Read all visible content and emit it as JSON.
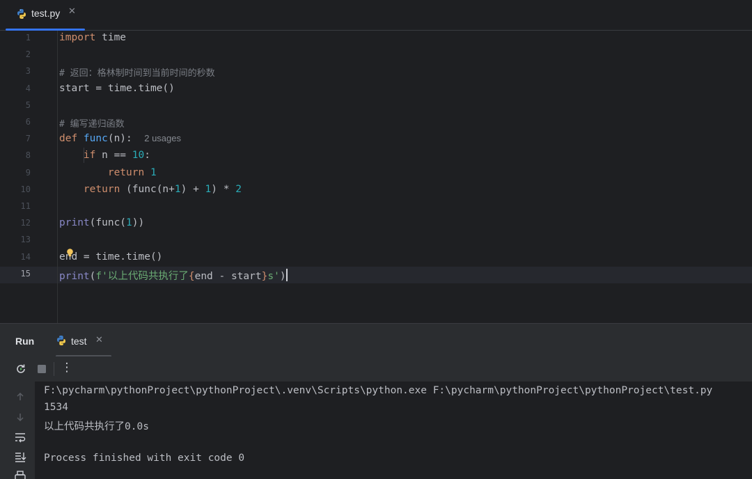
{
  "editor_tab": {
    "filename": "test.py",
    "close_glyph": "✕",
    "icon": "python-file-icon"
  },
  "editor": {
    "current_line": 15,
    "lines": [
      {
        "num": "1",
        "tokens": [
          {
            "t": "import",
            "c": "kw"
          },
          {
            "t": " time",
            "c": ""
          }
        ]
      },
      {
        "num": "2",
        "tokens": []
      },
      {
        "num": "3",
        "tokens": [
          {
            "t": "# 返回：格林制时间到当前时间的秒数",
            "c": "cm"
          }
        ]
      },
      {
        "num": "4",
        "tokens": [
          {
            "t": "start = time.time()",
            "c": ""
          }
        ]
      },
      {
        "num": "5",
        "tokens": []
      },
      {
        "num": "6",
        "tokens": [
          {
            "t": "# 编写递归函数",
            "c": "cm"
          }
        ]
      },
      {
        "num": "7",
        "tokens": [
          {
            "t": "def ",
            "c": "kw"
          },
          {
            "t": "func",
            "c": "fn"
          },
          {
            "t": "(n):  ",
            "c": ""
          },
          {
            "t": "2 usages",
            "c": "hint"
          }
        ]
      },
      {
        "num": "8",
        "tokens": [
          {
            "t": "    ",
            "c": ""
          },
          {
            "t": "if",
            "c": "kw"
          },
          {
            "t": " n == ",
            "c": ""
          },
          {
            "t": "10",
            "c": "num"
          },
          {
            "t": ":",
            "c": ""
          }
        ]
      },
      {
        "num": "9",
        "tokens": [
          {
            "t": "        ",
            "c": ""
          },
          {
            "t": "return",
            "c": "kw"
          },
          {
            "t": " ",
            "c": ""
          },
          {
            "t": "1",
            "c": "num"
          }
        ]
      },
      {
        "num": "10",
        "tokens": [
          {
            "t": "    ",
            "c": ""
          },
          {
            "t": "return",
            "c": "kw"
          },
          {
            "t": " (func(n+",
            "c": ""
          },
          {
            "t": "1",
            "c": "num"
          },
          {
            "t": ") + ",
            "c": ""
          },
          {
            "t": "1",
            "c": "num"
          },
          {
            "t": ") * ",
            "c": ""
          },
          {
            "t": "2",
            "c": "num"
          }
        ]
      },
      {
        "num": "11",
        "tokens": []
      },
      {
        "num": "12",
        "tokens": [
          {
            "t": "print",
            "c": "bi"
          },
          {
            "t": "(func(",
            "c": ""
          },
          {
            "t": "1",
            "c": "num"
          },
          {
            "t": "))",
            "c": ""
          }
        ]
      },
      {
        "num": "13",
        "tokens": []
      },
      {
        "num": "14",
        "tokens": [
          {
            "t": "end = time.time()",
            "c": ""
          }
        ]
      },
      {
        "num": "15",
        "tokens": [
          {
            "t": "print",
            "c": "bi"
          },
          {
            "t": "(",
            "c": ""
          },
          {
            "t": "f'以上代码共执行了",
            "c": "str"
          },
          {
            "t": "{",
            "c": "kw"
          },
          {
            "t": "end - start",
            "c": ""
          },
          {
            "t": "}",
            "c": "kw"
          },
          {
            "t": "s'",
            "c": "str"
          },
          {
            "t": ")",
            "c": ""
          }
        ]
      }
    ]
  },
  "run_panel": {
    "title": "Run",
    "tab_label": "test",
    "tab_close_glyph": "✕",
    "tab_icon": "python-file-icon",
    "toolbar": [
      "rerun-icon",
      "stop-icon",
      "more-options-icon"
    ],
    "more_glyph": "⋮",
    "side_buttons": [
      "scroll-up-icon",
      "scroll-down-icon",
      "soft-wrap-icon",
      "scroll-to-end-icon",
      "print-icon"
    ],
    "console_lines": [
      "F:\\pycharm\\pythonProject\\pythonProject\\.venv\\Scripts\\python.exe F:\\pycharm\\pythonProject\\pythonProject\\test.py",
      "1534",
      "以上代码共执行了0.0s",
      "",
      "Process finished with exit code 0"
    ]
  },
  "colors": {
    "background": "#1e1f22",
    "panel": "#2b2d30",
    "accent": "#3574f0",
    "keyword": "#cf8e6d",
    "function": "#56a8f5",
    "number": "#2aacb8",
    "string": "#6aab73",
    "comment": "#7a7e85",
    "builtin": "#8888c6"
  }
}
